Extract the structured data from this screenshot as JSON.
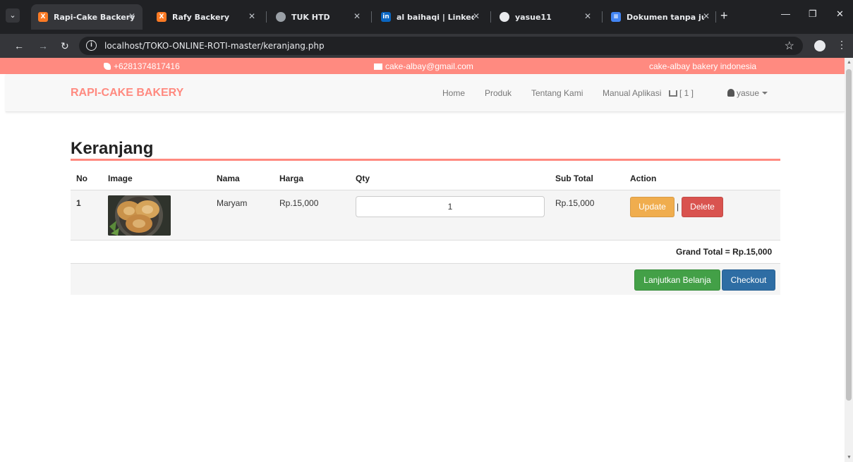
{
  "browser": {
    "tabs": [
      {
        "title": "Rapi-Cake Backery",
        "favicon": "xampp-icon",
        "active": true
      },
      {
        "title": "Rafy Backery",
        "favicon": "xampp-icon",
        "active": false
      },
      {
        "title": "TUK HTD",
        "favicon": "globe-icon",
        "active": false
      },
      {
        "title": "al baihaqi | LinkedIn",
        "favicon": "linkedin-icon",
        "active": false
      },
      {
        "title": "yasue11",
        "favicon": "github-icon",
        "active": false
      },
      {
        "title": "Dokumen tanpa judu",
        "favicon": "docs-icon",
        "active": false
      }
    ],
    "url": "localhost/TOKO-ONLINE-ROTI-master/keranjang.php",
    "colors": {
      "frame": "#202124",
      "toolbar": "#35363a"
    }
  },
  "topbar": {
    "phone": "+6281374817416",
    "email": "cake-albay@gmail.com",
    "tagline": "cake-albay bakery indonesia",
    "color": "#ff8a80"
  },
  "navbar": {
    "brand": "RAPI-CAKE BAKERY",
    "links": [
      "Home",
      "Produk",
      "Tentang Kami",
      "Manual Aplikasi"
    ],
    "cart": "[ 1 ]",
    "user": "yasue"
  },
  "cart": {
    "title": "Keranjang",
    "headers": [
      "No",
      "Image",
      "Nama",
      "Harga",
      "Qty",
      "Sub Total",
      "Action"
    ],
    "rows": [
      {
        "no": "1",
        "image": "product-maryam-photo",
        "nama": "Maryam",
        "harga": "Rp.15,000",
        "qty": "1",
        "subtotal": "Rp.15,000",
        "update_label": "Update",
        "separator": "|",
        "delete_label": "Delete"
      }
    ],
    "grand_total": "Grand Total = Rp.15,000",
    "continue_label": "Lanjutkan Belanja",
    "checkout_label": "Checkout"
  }
}
